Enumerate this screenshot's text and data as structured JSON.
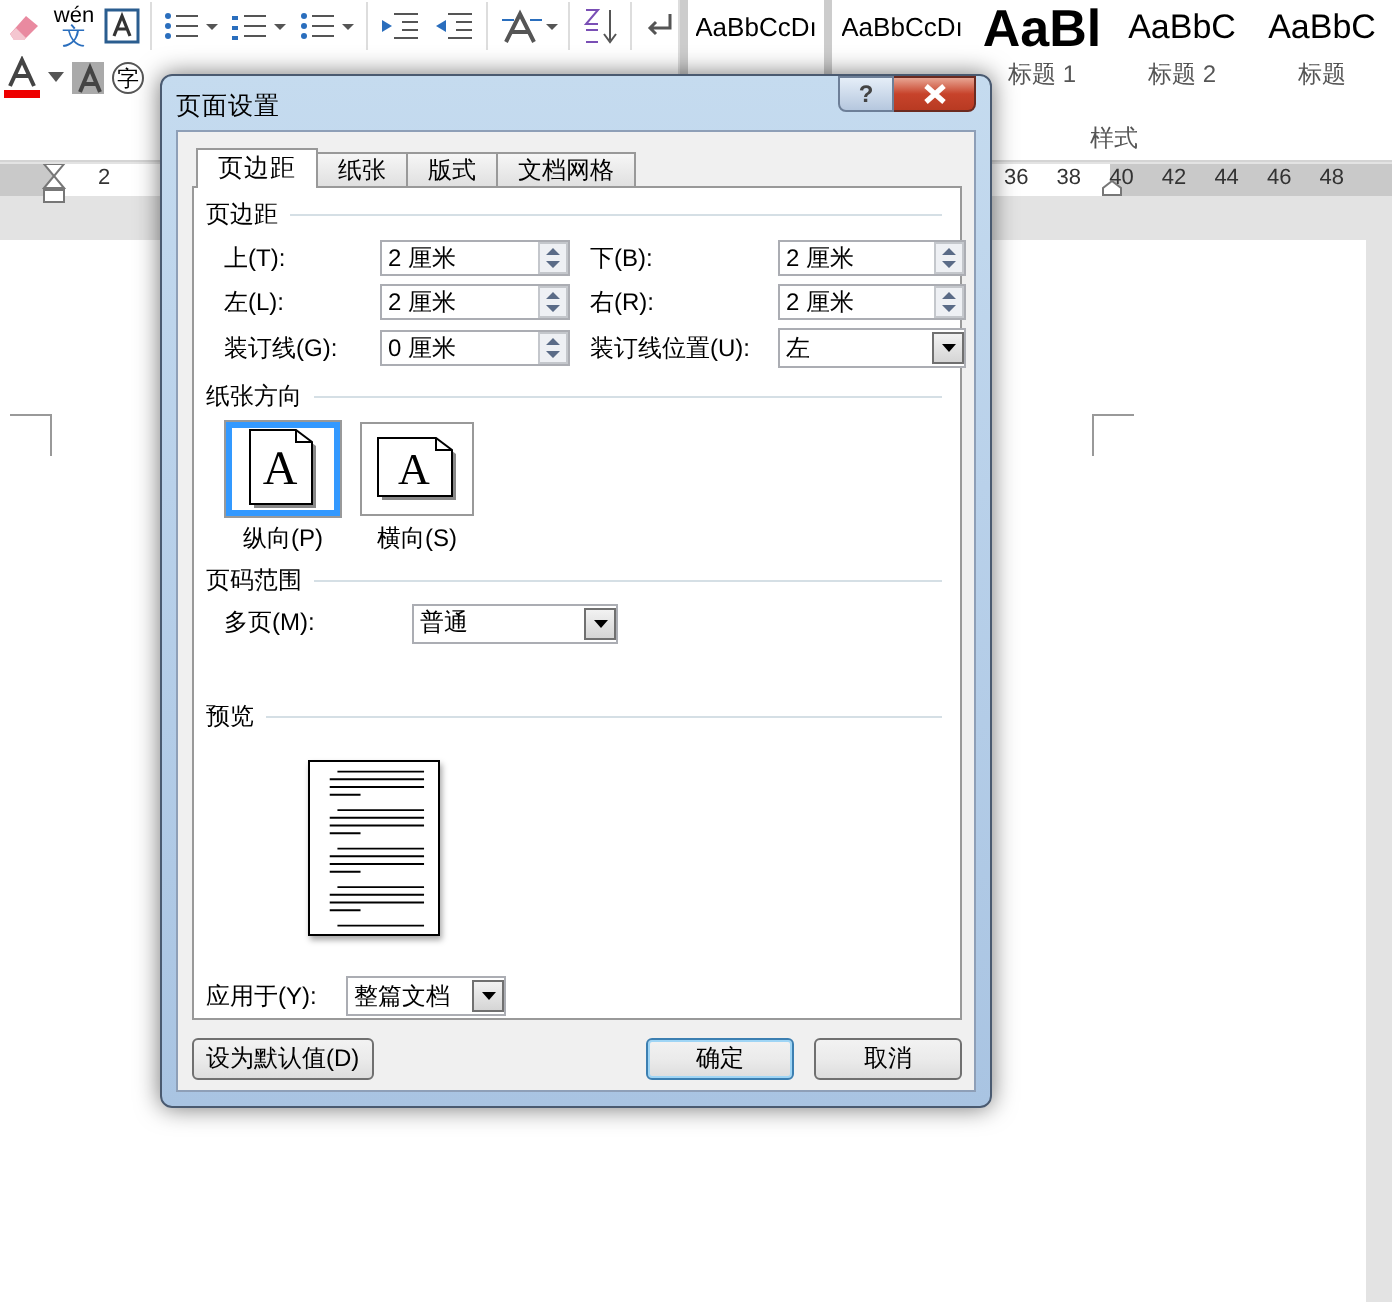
{
  "ribbon": {
    "phonetic_button": {
      "pinyin": "wén",
      "char": "文"
    },
    "enclose_button": "字",
    "styles": [
      {
        "preview": "AaBbCcDı",
        "kind": "normal"
      },
      {
        "preview": "AaBbCcDı",
        "kind": "normal"
      },
      {
        "preview": "AaBl",
        "kind": "heading",
        "label": "标题 1"
      },
      {
        "preview": "AaBbC",
        "kind": "subheading",
        "label": "标题 2"
      },
      {
        "preview": "AaBbC",
        "kind": "subheading",
        "label": "标题"
      }
    ],
    "group_label": "样式"
  },
  "ruler": {
    "left_numbers": [
      "2"
    ],
    "right_numbers": [
      "36",
      "38",
      "40",
      "42",
      "44",
      "46",
      "48"
    ]
  },
  "dialog": {
    "title": "页面设置",
    "help": "?",
    "tabs": [
      {
        "label": "页边距",
        "selected": true
      },
      {
        "label": "纸张",
        "selected": false
      },
      {
        "label": "版式",
        "selected": false
      },
      {
        "label": "文档网格",
        "selected": false
      }
    ],
    "margins": {
      "title": "页边距",
      "fields": [
        {
          "label": "上(T):",
          "value": "2 厘米",
          "kind": "spin"
        },
        {
          "label": "下(B):",
          "value": "2 厘米",
          "kind": "spin"
        },
        {
          "label": "左(L):",
          "value": "2 厘米",
          "kind": "spin"
        },
        {
          "label": "右(R):",
          "value": "2 厘米",
          "kind": "spin"
        },
        {
          "label": "装订线(G):",
          "value": "0 厘米",
          "kind": "spin"
        },
        {
          "label": "装订线位置(U):",
          "value": "左",
          "kind": "combo"
        }
      ]
    },
    "orientation": {
      "title": "纸张方向",
      "options": [
        {
          "glyph": "A",
          "label": "纵向(P)",
          "kind": "portrait",
          "selected": true
        },
        {
          "glyph": "A",
          "label": "横向(S)",
          "kind": "landscape",
          "selected": false
        }
      ]
    },
    "pages": {
      "title": "页码范围",
      "label": "多页(M):",
      "value": "普通"
    },
    "preview": {
      "title": "预览"
    },
    "apply": {
      "label": "应用于(Y):",
      "value": "整篇文档"
    },
    "buttons": [
      {
        "label": "设为默认值(D)",
        "kind": "left",
        "default": false
      },
      {
        "label": "确定",
        "kind": "right",
        "default": true
      },
      {
        "label": "取消",
        "kind": "right",
        "default": false
      }
    ]
  }
}
